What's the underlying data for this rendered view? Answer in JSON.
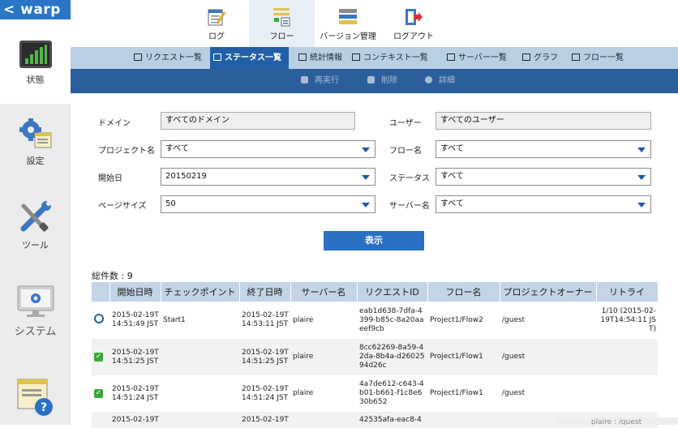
{
  "app": {
    "logo": "< warp"
  },
  "sidebar": {
    "items": [
      {
        "label": "状態"
      },
      {
        "label": "設定"
      },
      {
        "label": "ツール"
      },
      {
        "label": "システム"
      }
    ]
  },
  "topnav": {
    "items": [
      {
        "label": "ログ"
      },
      {
        "label": "フロー"
      },
      {
        "label": "バージョン管理"
      },
      {
        "label": "ログアウト"
      }
    ]
  },
  "subnav": {
    "items": [
      {
        "label": "リクエスト一覧"
      },
      {
        "label": "ステータス一覧"
      },
      {
        "label": "統計情報"
      },
      {
        "label": "コンテキスト一覧"
      },
      {
        "label": "サーバー一覧"
      },
      {
        "label": "グラフ"
      },
      {
        "label": "フロー一覧"
      }
    ]
  },
  "actions": {
    "rerun": "再実行",
    "delete": "削除",
    "detail": "詳細"
  },
  "filters": {
    "domain": {
      "label": "ドメイン",
      "value": "すべてのドメイン"
    },
    "user": {
      "label": "ユーザー",
      "value": "すべてのユーザー"
    },
    "project": {
      "label": "プロジェクト名",
      "value": "すべて"
    },
    "flow": {
      "label": "フロー名",
      "value": "すべて"
    },
    "start_date": {
      "label": "開始日",
      "value": "20150219"
    },
    "status": {
      "label": "ステータス",
      "value": "すべて"
    },
    "page_size": {
      "label": "ページサイズ",
      "value": "50"
    },
    "server": {
      "label": "サーバー名",
      "value": "すべて"
    }
  },
  "show_button": "表示",
  "total": "総件数 : 9",
  "table": {
    "headers": [
      "",
      "開始日時",
      "チェックポイント",
      "終了日時",
      "サーバー名",
      "リクエストID",
      "フロー名",
      "プロジェクトオーナー",
      "リトライ"
    ],
    "rows": [
      {
        "status": "waiting",
        "start": "2015-02-19T 14:51:49 JST",
        "checkpoint": "Start1",
        "end": "2015-02-19T 14:53:11 JST",
        "server": "plaire",
        "request_id": "eab1d638-7dfa-4399-b85c-8a20aaeef9cb",
        "flow": "Project1/Flow2",
        "owner": "/guest",
        "retry": "1/10 (2015-02-19T14:54:11 JST)"
      },
      {
        "status": "ok",
        "start": "2015-02-19T 14:51:25 JST",
        "checkpoint": "",
        "end": "2015-02-19T 14:51:25 JST",
        "server": "plaire",
        "request_id": "8cc62269-8a59-42da-8b4a-d2602594d26c",
        "flow": "Project1/Flow1",
        "owner": "/guest",
        "retry": ""
      },
      {
        "status": "ok",
        "start": "2015-02-19T 14:51:24 JST",
        "checkpoint": "",
        "end": "2015-02-19T 14:51:24 JST",
        "server": "plaire",
        "request_id": "4a7de612-c643-4b01-b661-f1c8e630b652",
        "flow": "Project1/Flow1",
        "owner": "/guest",
        "retry": ""
      },
      {
        "status": "",
        "start": "2015-02-19T",
        "checkpoint": "",
        "end": "2015-02-19T",
        "server": "",
        "request_id": "42535afa-eac8-4",
        "flow": "",
        "owner": "",
        "retry": ""
      }
    ]
  },
  "footer": "plaire : /guest"
}
